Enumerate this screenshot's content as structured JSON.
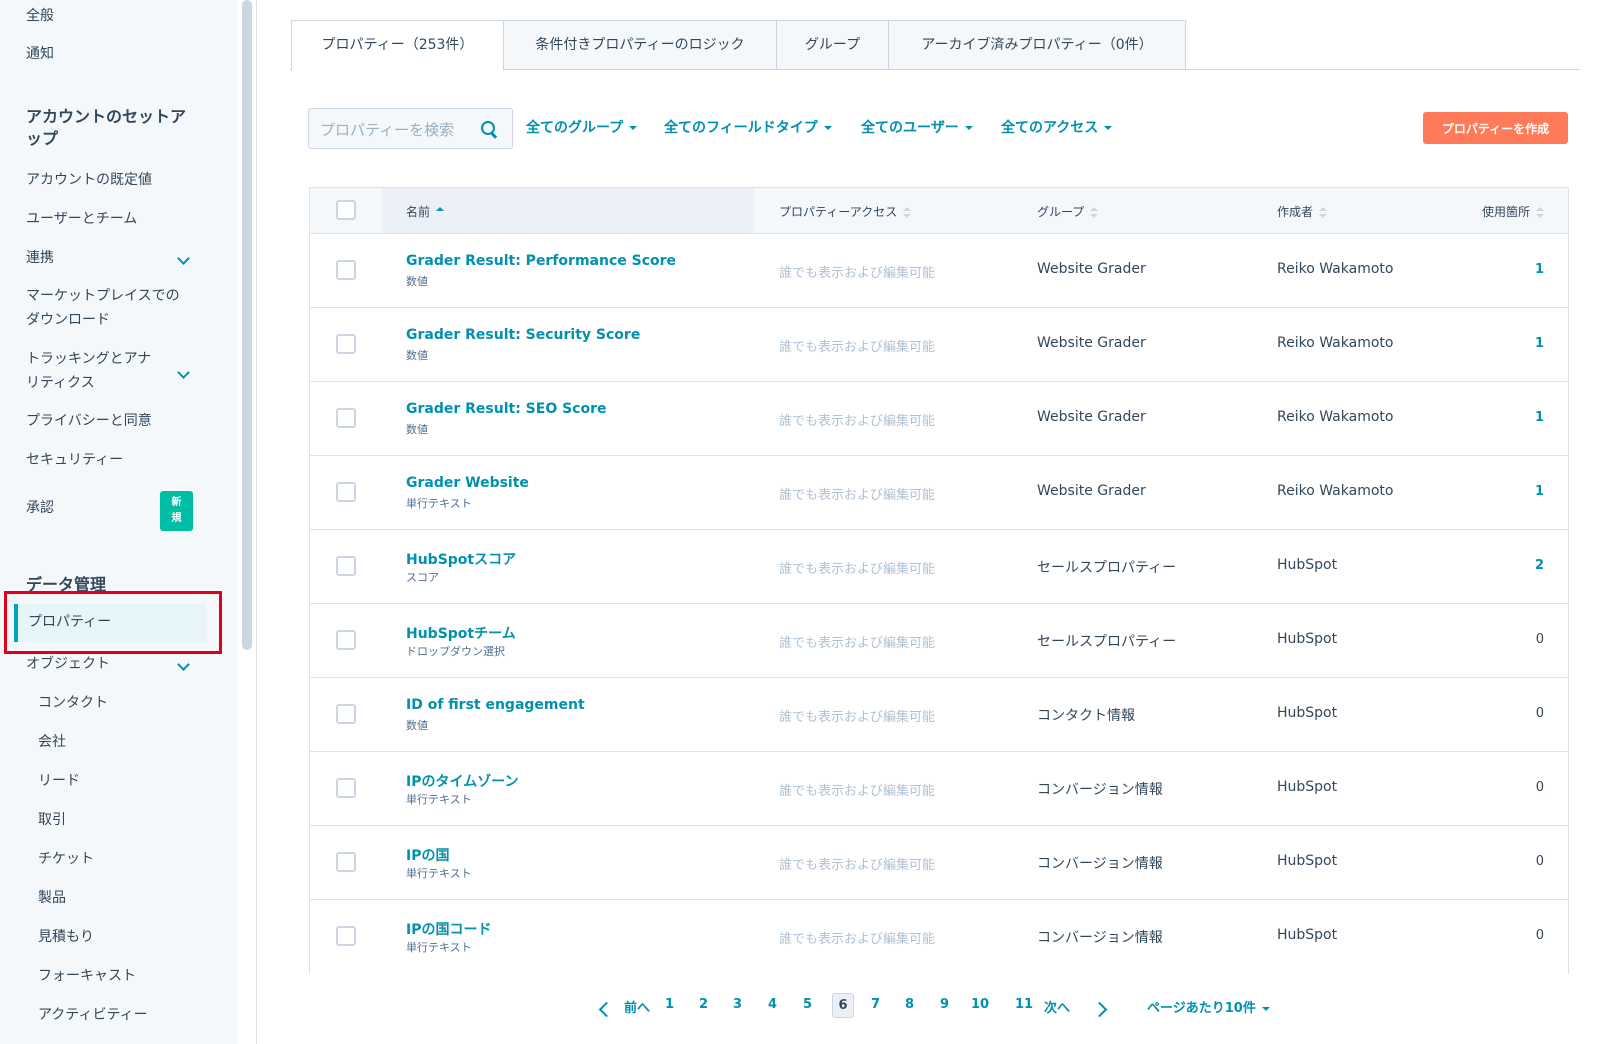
{
  "sidebar": {
    "top_items": [
      "全般",
      "通知"
    ],
    "account_setup_heading": "アカウントのセットアップ",
    "account_setup_heading_line1": "アカウントのセットア",
    "account_setup_heading_line2": "ップ",
    "account_items": {
      "defaults": "アカウントの既定値",
      "users_teams": "ユーザーとチーム",
      "integrations": "連携",
      "marketplace_line1": "マーケットプレイスでの",
      "marketplace_line2": "ダウンロード",
      "tracking_line1": "トラッキングとアナ",
      "tracking_line2": "リティクス",
      "privacy": "プライバシーと同意",
      "security": "セキュリティー",
      "approvals": "承認",
      "new_badge_line1": "新",
      "new_badge_line2": "規"
    },
    "data_management_heading": "データ管理",
    "properties_item": "プロパティー",
    "objects_item": "オブジェクト",
    "object_sub_items": [
      "コンタクト",
      "会社",
      "リード",
      "取引",
      "チケット",
      "製品",
      "見積もり",
      "フォーキャスト",
      "アクティビティー"
    ]
  },
  "tabs": [
    {
      "label": "プロパティー（253件）",
      "active": true
    },
    {
      "label": "条件付きプロパティーのロジック",
      "active": false
    },
    {
      "label": "グループ",
      "active": false
    },
    {
      "label": "アーカイブ済みプロパティー（0件）",
      "active": false
    }
  ],
  "filters": {
    "search_placeholder": "プロパティーを検索",
    "groups": "全てのグループ",
    "field_types": "全てのフィールドタイプ",
    "users": "全てのユーザー",
    "access": "全てのアクセス",
    "create_button": "プロパティーを作成"
  },
  "table": {
    "columns": {
      "name": "名前",
      "access": "プロパティーアクセス",
      "group": "グループ",
      "creator": "作成者",
      "usage": "使用箇所"
    },
    "rows": [
      {
        "name": "Grader Result: Performance Score",
        "type": "数値",
        "access": "誰でも表示および編集可能",
        "group": "Website Grader",
        "creator": "Reiko Wakamoto",
        "usage": "1"
      },
      {
        "name": "Grader Result: Security Score",
        "type": "数値",
        "access": "誰でも表示および編集可能",
        "group": "Website Grader",
        "creator": "Reiko Wakamoto",
        "usage": "1"
      },
      {
        "name": "Grader Result: SEO Score",
        "type": "数値",
        "access": "誰でも表示および編集可能",
        "group": "Website Grader",
        "creator": "Reiko Wakamoto",
        "usage": "1"
      },
      {
        "name": "Grader Website",
        "type": "単行テキスト",
        "access": "誰でも表示および編集可能",
        "group": "Website Grader",
        "creator": "Reiko Wakamoto",
        "usage": "1"
      },
      {
        "name": "HubSpotスコア",
        "type": "スコア",
        "access": "誰でも表示および編集可能",
        "group": "セールスプロパティー",
        "creator": "HubSpot",
        "usage": "2"
      },
      {
        "name": "HubSpotチーム",
        "type": "ドロップダウン選択",
        "access": "誰でも表示および編集可能",
        "group": "セールスプロパティー",
        "creator": "HubSpot",
        "usage": "0"
      },
      {
        "name": "ID of first engagement",
        "type": "数値",
        "access": "誰でも表示および編集可能",
        "group": "コンタクト情報",
        "creator": "HubSpot",
        "usage": "0"
      },
      {
        "name": "IPのタイムゾーン",
        "type": "単行テキスト",
        "access": "誰でも表示および編集可能",
        "group": "コンバージョン情報",
        "creator": "HubSpot",
        "usage": "0"
      },
      {
        "name": "IPの国",
        "type": "単行テキスト",
        "access": "誰でも表示および編集可能",
        "group": "コンバージョン情報",
        "creator": "HubSpot",
        "usage": "0"
      },
      {
        "name": "IPの国コード",
        "type": "単行テキスト",
        "access": "誰でも表示および編集可能",
        "group": "コンバージョン情報",
        "creator": "HubSpot",
        "usage": "0"
      }
    ]
  },
  "pagination": {
    "prev": "前へ",
    "next": "次へ",
    "pages": [
      "1",
      "2",
      "3",
      "4",
      "5",
      "6",
      "7",
      "8",
      "9",
      "10",
      "11"
    ],
    "current": "6",
    "per_page": "ページあたり10件"
  },
  "colors": {
    "accent": "#0091ae",
    "create_button": "#ff7a59",
    "badge": "#00bda5",
    "highlight": "#e0001a"
  }
}
